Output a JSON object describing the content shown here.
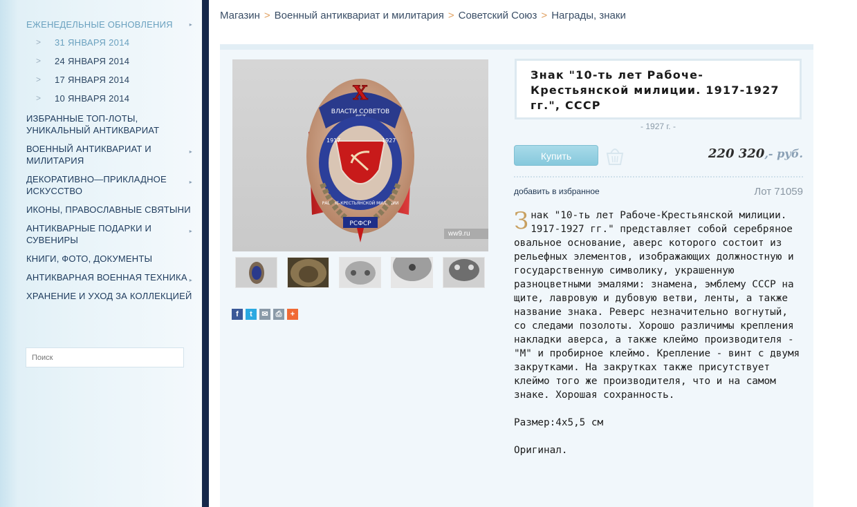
{
  "sidebar": {
    "weekly_updates": {
      "label": "ЕЖЕНЕДЕЛЬНЫЕ ОБНОВЛЕНИЯ",
      "dates": [
        "31 Января 2014",
        "24 Января 2014",
        "17 Января 2014",
        "10 Января 2014"
      ]
    },
    "items": [
      {
        "label": "ИЗБРАННЫЕ ТОП-ЛОТЫ, УНИКАЛЬНЫЙ АНТИКВАРИАТ"
      },
      {
        "label": "ВОЕННЫЙ АНТИКВАРИАТ И МИЛИТАРИЯ"
      },
      {
        "label": "ДЕКОРАТИВНО—ПРИКЛАДНОЕ ИСКУССТВО"
      },
      {
        "label": "ИКОНЫ, ПРАВОСЛАВНЫЕ СВЯТЫНИ"
      },
      {
        "label": "АНТИКВАРНЫЕ ПОДАРКИ И СУВЕНИРЫ"
      },
      {
        "label": "КНИГИ, ФОТО, ДОКУМЕНТЫ"
      },
      {
        "label": "АНТИКВАРНАЯ ВОЕННАЯ ТЕХНИКА"
      },
      {
        "label": "ХРАНЕНИЕ И УХОД ЗА КОЛЛЕКЦИЕЙ"
      }
    ],
    "search_placeholder": "Поиск"
  },
  "breadcrumb": [
    "Магазин",
    "Военный антиквариат и милитария",
    "Советский Союз",
    "Награды, знаки"
  ],
  "breadcrumb_sep": ">",
  "product": {
    "title": "Знак \"10-ть лет Рабоче-Крестьянской милиции. 1917-1927 гг.\", СССР",
    "year": "- 1927 г. -",
    "buy_label": "Купить",
    "price": "220 320",
    "currency": ",- руб.",
    "favorite_label": "добавить в избранное",
    "lot": "Лот 71059",
    "watermark": "ww9.ru",
    "badge_x": "X",
    "badge_top_text": "ВЛАСТИ СОВЕТОВ",
    "badge_let": "ЛЕТ",
    "badge_ring": "РАБОЧЕ-КРЕСТЬЯНСКОЙ МИЛИЦИИ",
    "badge_years_left": "1917",
    "badge_years_right": "1927",
    "badge_bottom": "РСФСР",
    "description_dropcap": "З",
    "description": "нак \"10-ть лет Рабоче-Крестьянской милиции. 1917-1927 гг.\" представляет собой серебряное овальное основание, аверс которого состоит из рельефных элементов, изображающих должностную и государственную символику, украшенную разноцветными эмалями: знамена, эмблему СССР на щите, лавровую и дубовую ветви, ленты, а также название знака. Реверс незначительно вогнутый, со следами позолоты. Хорошо различимы крепления накладки аверса, а также клеймо производителя - \"М\" и пробирное клеймо. Крепление - винт с двумя закрутками. На закрутках также присутствует клеймо того же производителя, что и на самом знаке. Хорошая сохранность.",
    "size": "Размер:4х5,5 см",
    "original": "Оригинал."
  },
  "colors": {
    "accent": "#6aa1bf",
    "dark_strip": "#15284a",
    "buy_button": "#9ad3e4",
    "dropcap": "#c8a060"
  },
  "icons": {
    "share": [
      "facebook-icon",
      "twitter-icon",
      "email-icon",
      "print-icon",
      "plus-icon"
    ],
    "basket": "basket-icon",
    "nav_arrow": "chevron-right-icon"
  }
}
